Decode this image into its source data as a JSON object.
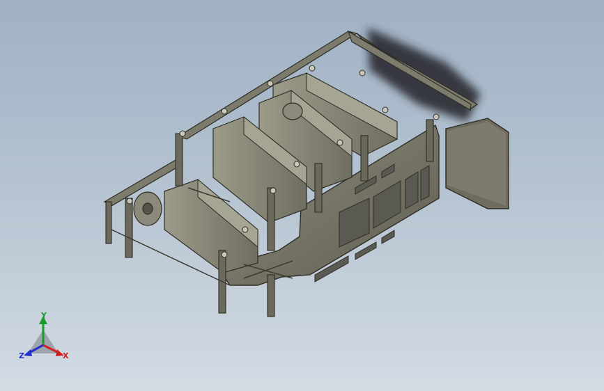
{
  "viewport": {
    "background_top": "#9fb1c4",
    "background_bottom": "#d3dbe3"
  },
  "model": {
    "body_color": "#7d7c6c",
    "dark_color": "#3f3e36",
    "light_color": "#bdbcad",
    "shadow_color": "#2a2c30"
  },
  "triad": {
    "y_label": "Y",
    "x_label": "X",
    "z_label": "Z",
    "y_color": "#1a9a2a",
    "x_color": "#d42020",
    "z_color": "#2030c8"
  }
}
